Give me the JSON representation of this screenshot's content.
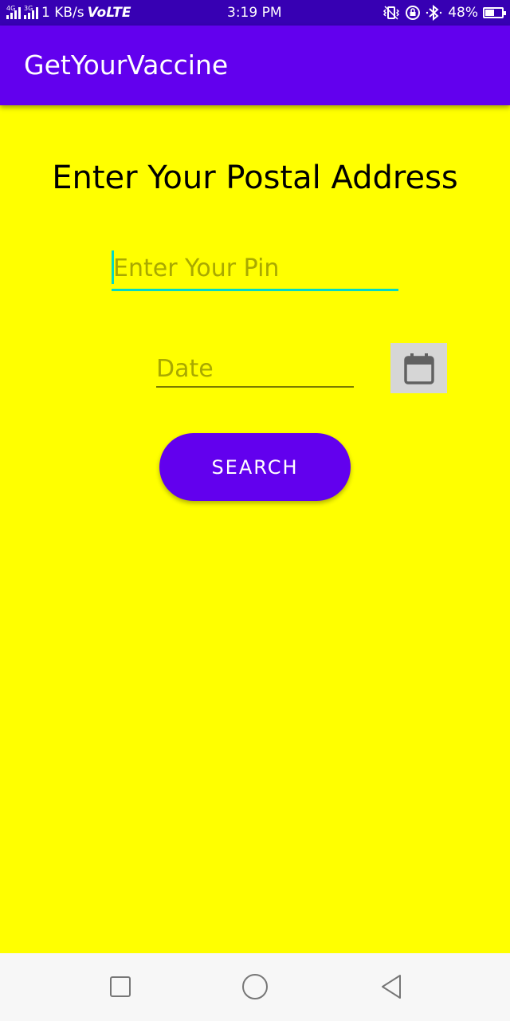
{
  "status_bar": {
    "network_type_1": "4G",
    "network_type_2": "3G",
    "data_speed": "1 KB/s",
    "volte": "VoLTE",
    "time": "3:19 PM",
    "battery_percent": "48%",
    "battery_level": 0.48,
    "icons": [
      "vibrate-icon",
      "rotation-lock-icon",
      "bluetooth-icon"
    ]
  },
  "app_bar": {
    "title": "GetYourVaccine",
    "color": "#6200ee"
  },
  "main": {
    "heading": "Enter Your Postal Address",
    "pin_input": {
      "placeholder": "Enter Your Pin",
      "value": ""
    },
    "date_input": {
      "placeholder": "Date",
      "value": ""
    },
    "calendar_button_icon": "calendar-icon",
    "search_button": {
      "label": "SEARCH"
    },
    "background_color": "#ffff00",
    "accent_color": "#03dac5"
  },
  "nav_bar": {
    "buttons": [
      "recents-square-icon",
      "home-circle-icon",
      "back-triangle-icon"
    ]
  }
}
